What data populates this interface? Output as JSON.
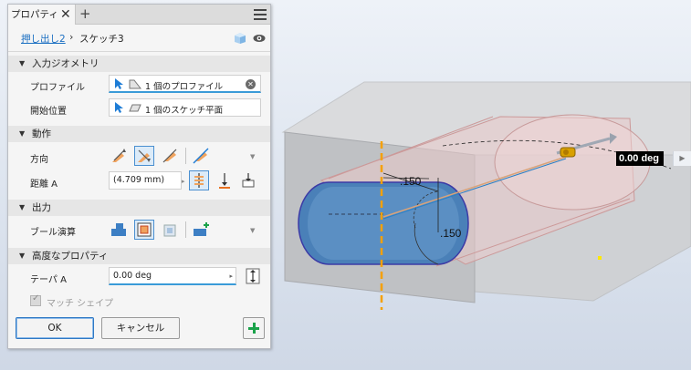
{
  "panel": {
    "tab_label": "プロパティ",
    "tab_close": "✕",
    "tab_add": "+",
    "breadcrumb": {
      "parent": "押し出し2",
      "separator": "›",
      "current": "スケッチ3"
    },
    "sections": {
      "input_geometry": "入力ジオメトリ",
      "behavior": "動作",
      "output": "出力",
      "advanced": "高度なプロパティ"
    },
    "profile": {
      "label": "プロファイル",
      "value": "1 個のプロファイル",
      "clear_icon": "✕"
    },
    "start": {
      "label": "開始位置",
      "value": "1 個のスケッチ平面"
    },
    "direction": {
      "label": "方向"
    },
    "distance": {
      "label": "距離 A",
      "value": "(4.709 mm)"
    },
    "boolean": {
      "label": "ブール演算"
    },
    "taper": {
      "label": "テーパ A",
      "value": "0.00 deg"
    },
    "match_shape": {
      "label": "マッチ シェイプ",
      "checked": true
    },
    "buttons": {
      "ok": "OK",
      "cancel": "キャンセル"
    }
  },
  "viewport": {
    "taper_readout": "0.00 deg",
    "dim_1": ".150",
    "dim_2": ".150"
  },
  "colors": {
    "accent": "#1b6fc2",
    "selection": "#3a9bd8",
    "add_green": "#1aa24a",
    "profile_fill": "#3e78b3",
    "centerline": "#f5a000"
  },
  "icons": [
    "cursor-arrow-icon",
    "profile-shape-icon",
    "clear-icon",
    "sketch-plane-icon",
    "direction-default-icon",
    "direction-flipped-icon",
    "direction-symmetric-icon",
    "direction-asymmetric-icon",
    "distance-icon",
    "to-next-icon",
    "to-icon",
    "join-icon",
    "cut-icon",
    "intersect-icon",
    "new-solid-icon",
    "taper-icon",
    "cube-icon",
    "eye-icon",
    "hamburger-menu-icon",
    "add-icon"
  ]
}
